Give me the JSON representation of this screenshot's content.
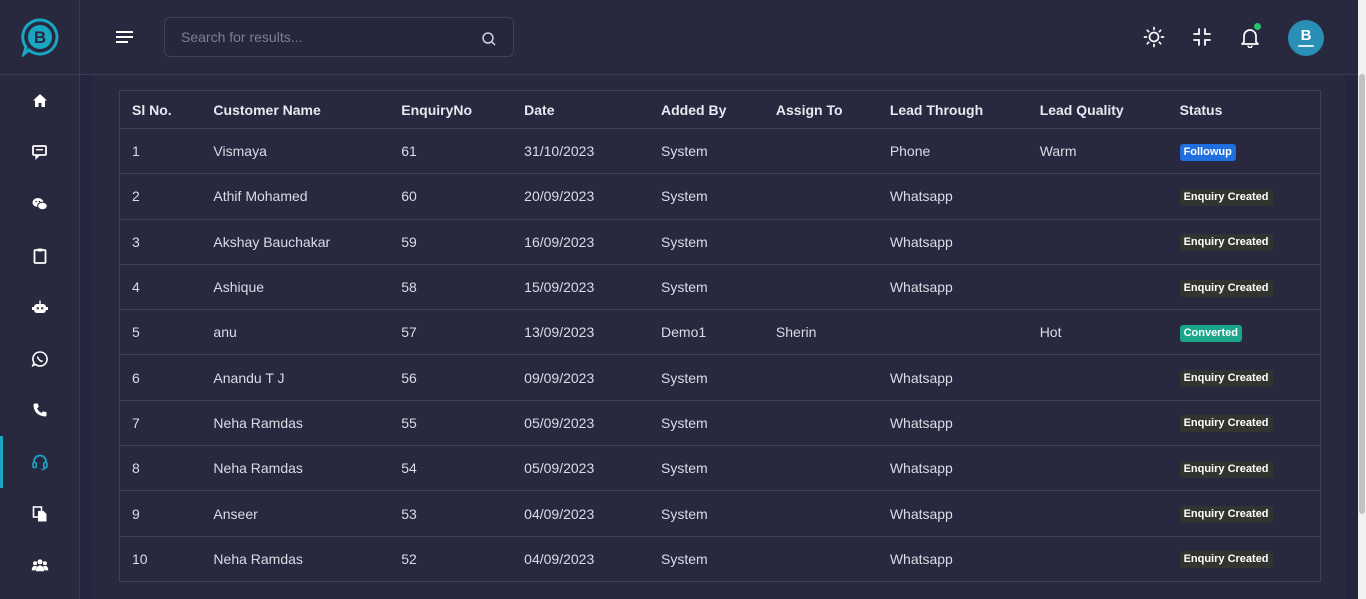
{
  "sidebar": {
    "logo_letter": "B",
    "items": [
      {
        "icon": "home-icon"
      },
      {
        "icon": "chat-icon"
      },
      {
        "icon": "wechat-icon"
      },
      {
        "icon": "clipboard-icon"
      },
      {
        "icon": "robot-icon"
      },
      {
        "icon": "whatsapp-icon"
      },
      {
        "icon": "phone-icon"
      },
      {
        "icon": "headset-icon",
        "active": true
      },
      {
        "icon": "documents-icon"
      },
      {
        "icon": "users-icon"
      }
    ]
  },
  "header": {
    "search_placeholder": "Search for results...",
    "avatar_letter": "B"
  },
  "colors": {
    "accent": "#1aa5c3",
    "followup": "#1f6fe0",
    "converted": "#1aa689",
    "enquiry_created": "#32342f",
    "notification": "#27c267"
  },
  "table": {
    "columns": [
      "Sl No.",
      "Customer Name",
      "EnquiryNo",
      "Date",
      "Added By",
      "Assign To",
      "Lead Through",
      "Lead Quality",
      "Status"
    ],
    "rows": [
      {
        "sl": "1",
        "name": "Vismaya",
        "enq": "61",
        "date": "31/10/2023",
        "added_by": "System",
        "assign_to": "",
        "lead_through": "Phone",
        "lead_quality": "Warm",
        "status": "Followup"
      },
      {
        "sl": "2",
        "name": "Athif Mohamed",
        "enq": "60",
        "date": "20/09/2023",
        "added_by": "System",
        "assign_to": "",
        "lead_through": "Whatsapp",
        "lead_quality": "",
        "status": "Enquiry Created"
      },
      {
        "sl": "3",
        "name": "Akshay Bauchakar",
        "enq": "59",
        "date": "16/09/2023",
        "added_by": "System",
        "assign_to": "",
        "lead_through": "Whatsapp",
        "lead_quality": "",
        "status": "Enquiry Created"
      },
      {
        "sl": "4",
        "name": "Ashique",
        "enq": "58",
        "date": "15/09/2023",
        "added_by": "System",
        "assign_to": "",
        "lead_through": "Whatsapp",
        "lead_quality": "",
        "status": "Enquiry Created"
      },
      {
        "sl": "5",
        "name": "anu",
        "enq": "57",
        "date": "13/09/2023",
        "added_by": "Demo1",
        "assign_to": "Sherin",
        "lead_through": "",
        "lead_quality": "Hot",
        "status": "Converted"
      },
      {
        "sl": "6",
        "name": "Anandu T J",
        "enq": "56",
        "date": "09/09/2023",
        "added_by": "System",
        "assign_to": "",
        "lead_through": "Whatsapp",
        "lead_quality": "",
        "status": "Enquiry Created"
      },
      {
        "sl": "7",
        "name": "Neha Ramdas",
        "enq": "55",
        "date": "05/09/2023",
        "added_by": "System",
        "assign_to": "",
        "lead_through": "Whatsapp",
        "lead_quality": "",
        "status": "Enquiry Created"
      },
      {
        "sl": "8",
        "name": "Neha Ramdas",
        "enq": "54",
        "date": "05/09/2023",
        "added_by": "System",
        "assign_to": "",
        "lead_through": "Whatsapp",
        "lead_quality": "",
        "status": "Enquiry Created"
      },
      {
        "sl": "9",
        "name": "Anseer",
        "enq": "53",
        "date": "04/09/2023",
        "added_by": "System",
        "assign_to": "",
        "lead_through": "Whatsapp",
        "lead_quality": "",
        "status": "Enquiry Created"
      },
      {
        "sl": "10",
        "name": "Neha Ramdas",
        "enq": "52",
        "date": "04/09/2023",
        "added_by": "System",
        "assign_to": "",
        "lead_through": "Whatsapp",
        "lead_quality": "",
        "status": "Enquiry Created"
      }
    ]
  }
}
